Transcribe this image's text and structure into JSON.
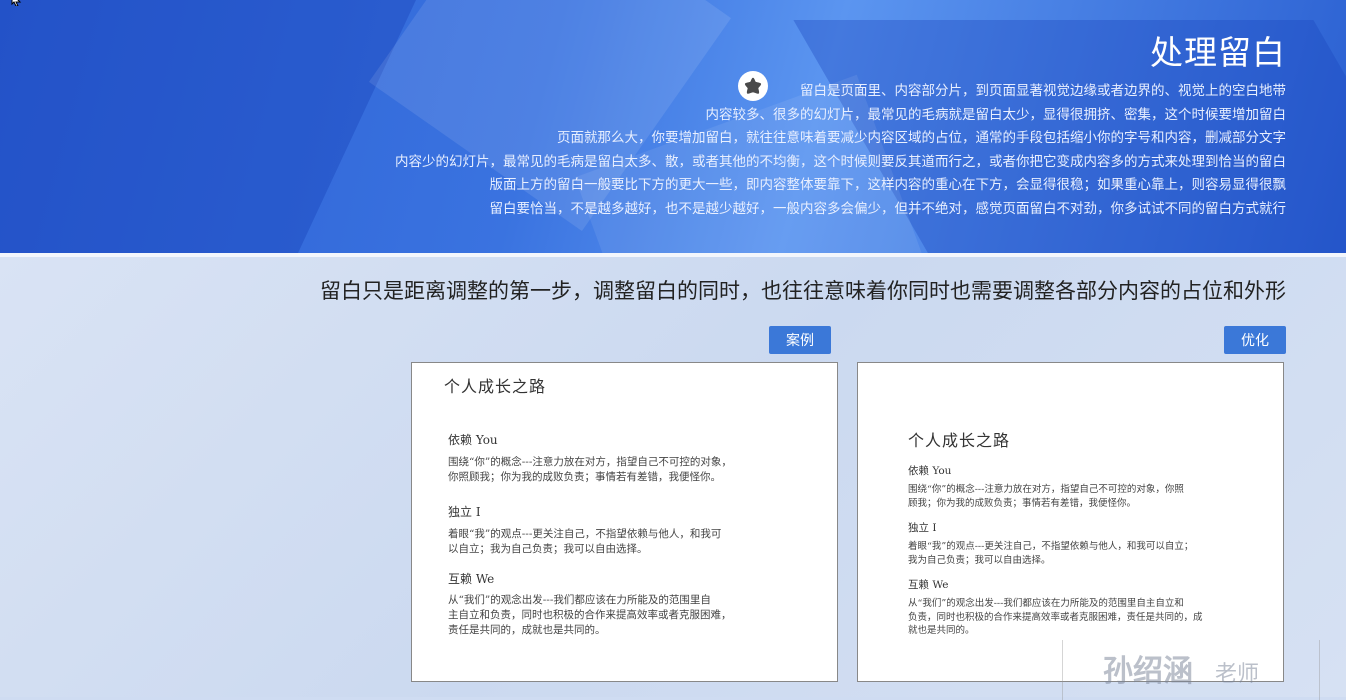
{
  "header": {
    "title": "处理留白",
    "description_lines": [
      "留白是页面里、内容部分片，到页面显著视觉边缘或者边界的、视觉上的空白地带",
      "内容较多、很多的幻灯片，最常见的毛病就是留白太少，显得很拥挤、密集，这个时候要增加留白",
      "页面就那么大，你要增加留白，就往往意味着要减少内容区域的占位，通常的手段包括缩小你的字号和内容，删减部分文字",
      "内容少的幻灯片，最常见的毛病是留白太多、散，或者其他的不均衡，这个时候则要反其道而行之，或者你把它变成内容多的方式来处理到恰当的留白",
      "版面上方的留白一般要比下方的更大一些，即内容整体要靠下，这样内容的重心在下方，会显得很稳；如果重心靠上，则容易显得很飘",
      "留白要恰当，不是越多越好，也不是越少越好，一般内容多会偏少，但并不绝对，感觉页面留白不对劲，你多试试不同的留白方式就行"
    ]
  },
  "subtitle": "留白只是距离调整的第一步，调整留白的同时，也往往意味着你同时也需要调整各部分内容的占位和外形",
  "tags": {
    "case": "案例",
    "optimized": "优化"
  },
  "card": {
    "title": "个人成长之路",
    "sections": [
      {
        "heading": "依赖 You",
        "body": "围绕“你”的概念---注意力放在对方，指望自己不可控的对象，你照顾我；你为我的成败负责；事情若有差错，我便怪你。",
        "left_lines": [
          "围绕“你”的概念---注意力放在对方，指望自己不可控的对象，",
          "你照顾我；你为我的成败负责；事情若有差错，我便怪你。"
        ],
        "right_lines": [
          "围绕“你”的概念---注意力放在对方，指望自己不可控的对象，你照",
          "顾我；你为我的成败负责；事情若有差错，我便怪你。"
        ]
      },
      {
        "heading": "独立 I",
        "body": "着眼“我”的观点---更关注自己，不指望依赖与他人，和我可以自立；我为自己负责；我可以自由选择。",
        "left_lines": [
          "着眼“我”的观点---更关注自己，不指望依赖与他人，和我可",
          "以自立；我为自己负责；我可以自由选择。"
        ],
        "right_lines": [
          "着眼“我”的观点---更关注自己，不指望依赖与他人，和我可以自立；",
          "我为自己负责；我可以自由选择。"
        ]
      },
      {
        "heading": "互赖 We",
        "body": "从“我们”的观念出发---我们都应该在力所能及的范围里自主自立和负责，同时也积极的合作来提高效率或者克服困难，责任是共同的，成就也是共同的。",
        "left_lines": [
          "从“我们”的观念出发---我们都应该在力所能及的范围里自",
          "主自立和负责，同时也积极的合作来提高效率或者克服困难，",
          "责任是共同的，成就也是共同的。"
        ],
        "right_lines": [
          "从“我们”的观念出发---我们都应该在力所能及的范围里自主自立和",
          "负责，同时也积极的合作来提高效率或者克服困难，责任是共同的，成",
          "就也是共同的。"
        ]
      }
    ]
  },
  "watermark": {
    "name": "孙绍涵",
    "role": "老师"
  },
  "colors": {
    "header_blue": "#2c5fd3",
    "tag_blue": "#3b78d8"
  },
  "icons": {
    "star": "star-icon"
  }
}
